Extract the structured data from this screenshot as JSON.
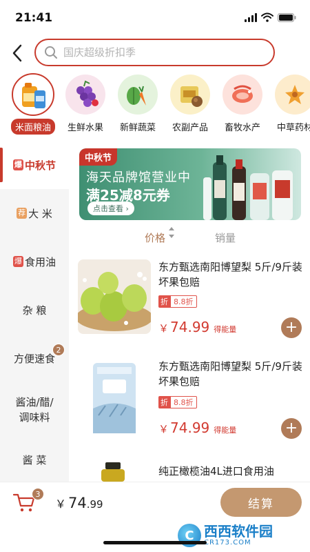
{
  "status_bar": {
    "time": "21:41"
  },
  "search": {
    "placeholder": "国庆超级折扣季"
  },
  "categories": [
    {
      "label": "米面粮油",
      "icon": "grain-oil-icon",
      "active": true
    },
    {
      "label": "生鲜水果",
      "icon": "grapes-icon"
    },
    {
      "label": "新鲜蔬菜",
      "icon": "vegetables-icon"
    },
    {
      "label": "农副产品",
      "icon": "produce-icon"
    },
    {
      "label": "畜牧水产",
      "icon": "seafood-icon"
    },
    {
      "label": "中草药材",
      "icon": "herbs-icon"
    }
  ],
  "sidebar": {
    "items": [
      {
        "tag": "爆",
        "label": "中秋节",
        "active": true
      },
      {
        "tag": "荐",
        "label": "大 米"
      },
      {
        "tag": "爆",
        "label": "食用油"
      },
      {
        "label": "杂 粮"
      },
      {
        "label": "方便速食",
        "badge": "2"
      },
      {
        "label": "酱油/醋/",
        "label2": "调味料"
      },
      {
        "label": "酱 菜"
      }
    ]
  },
  "banner": {
    "tag": "中秋节",
    "line1": "海天品牌馆营业中",
    "line2": "满25减8元券",
    "button": "点击查看 ›"
  },
  "sort": {
    "price": "价格",
    "sales": "销量"
  },
  "products": [
    {
      "title": "东方甄选南阳博望梨 5斤/9斤装 坏果包赔",
      "discount_tag": "折",
      "discount": "8.8折",
      "price_symbol": "￥",
      "price": "74.99",
      "price_note": "得能量"
    },
    {
      "title": "东方甄选南阳博望梨 5斤/9斤装 坏果包赔",
      "discount_tag": "折",
      "discount": "8.8折",
      "price_symbol": "￥",
      "price": "74.99",
      "price_note": "得能量"
    },
    {
      "title": "纯正橄榄油4L进口食用油"
    }
  ],
  "bottom_bar": {
    "cart_count": "3",
    "total_symbol": "￥",
    "total_int": "74",
    "total_dec": ".99",
    "checkout": "结算"
  },
  "watermark": {
    "logo": "C",
    "main": "西西软件园",
    "sub": "CR173.COM"
  },
  "colors": {
    "accent": "#c83a2c",
    "brown": "#b07b58",
    "price": "#d23a30",
    "checkout": "#c49870"
  }
}
